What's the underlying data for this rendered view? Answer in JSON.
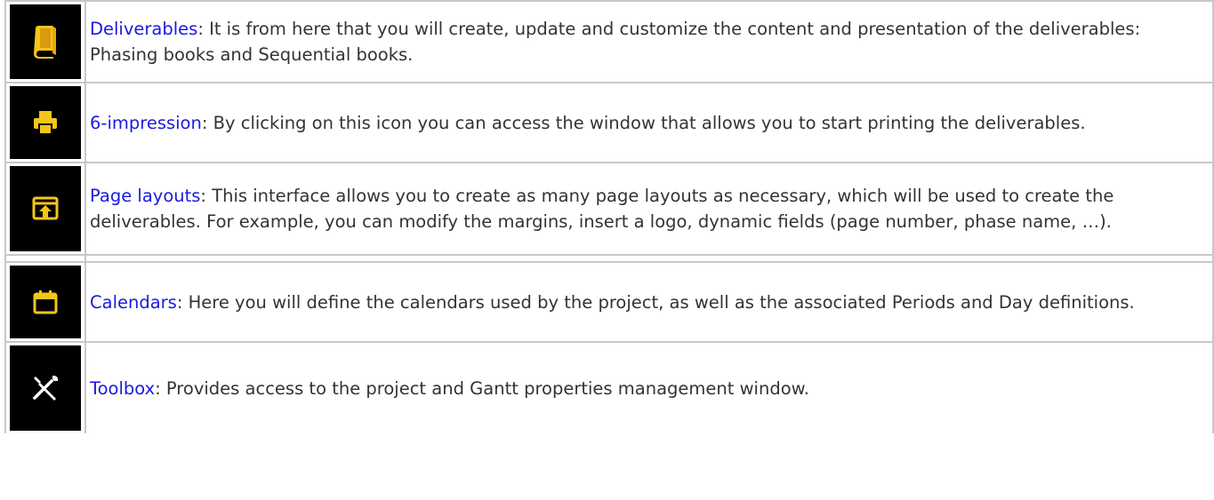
{
  "colors": {
    "link": "#1a1ae0",
    "icon_accent": "#f5c518",
    "icon_bg": "#000000",
    "text": "#333333",
    "border": "#c8c8c8"
  },
  "rows": [
    {
      "icon": "book-icon",
      "link": "Deliverables",
      "text": ": It is from here that you will create, update and customize the content and presentation of the deliverables: Phasing books and Sequential books."
    },
    {
      "icon": "printer-icon",
      "link": "6-impression",
      "text": ": By clicking on this icon you can access the window that allows you to start printing the deliverables."
    },
    {
      "icon": "page-layout-icon",
      "link": "Page layouts",
      "text": ": This interface allows you to create as many page layouts as necessary, which will be used to create the deliverables. For example, you can modify the margins, insert a logo, dynamic fields (page number, phase name, …)."
    },
    {
      "icon": "calendar-icon",
      "link": "Calendars",
      "text": ": Here you will define the calendars used by the project, as well as the associated Periods and Day definitions."
    },
    {
      "icon": "tools-icon",
      "link": "Toolbox",
      "text": ": Provides access to the project and Gantt properties management window."
    }
  ]
}
